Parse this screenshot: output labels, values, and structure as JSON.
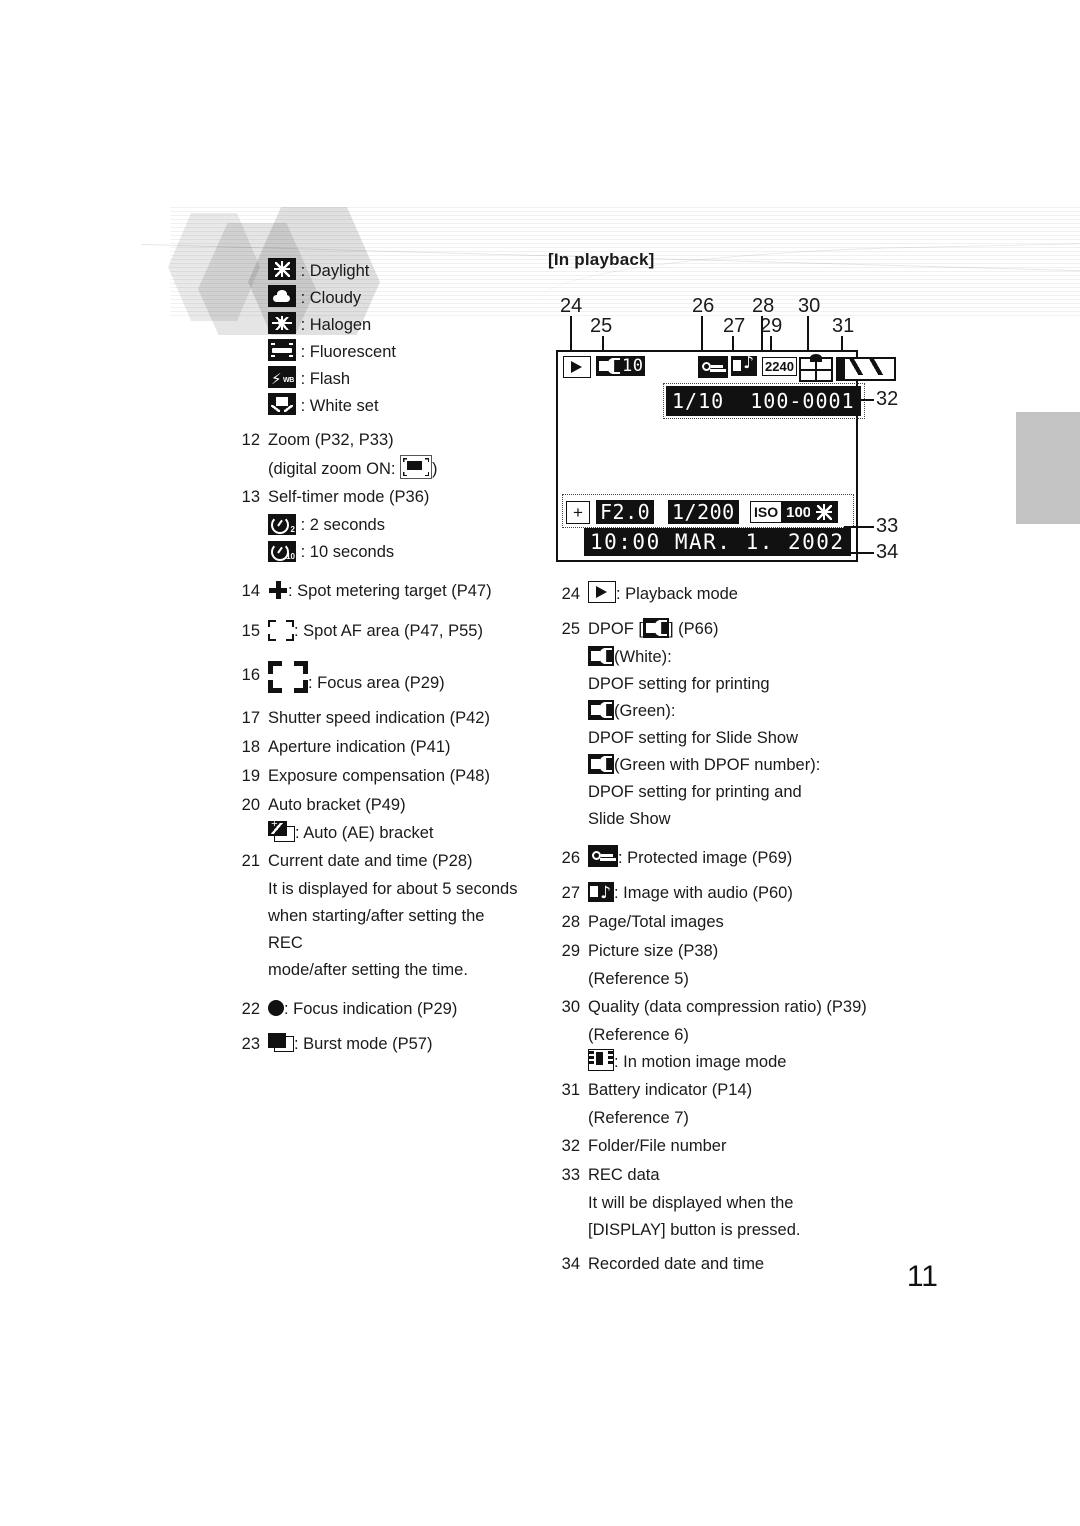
{
  "page": {
    "number": "11"
  },
  "left_column": {
    "wb_icons": [
      {
        "icon": "daylight-icon",
        "label": ": Daylight"
      },
      {
        "icon": "cloudy-icon",
        "label": ": Cloudy"
      },
      {
        "icon": "halogen-icon",
        "label": ": Halogen"
      },
      {
        "icon": "fluorescent-icon",
        "label": ": Fluorescent"
      },
      {
        "icon": "flash-wb-icon",
        "label": ": Flash"
      },
      {
        "icon": "white-set-icon",
        "label": ": White set"
      }
    ],
    "item12": {
      "num": "12",
      "text": "Zoom (P32, P33)",
      "sub_pre": "(digital zoom ON: ",
      "sub_post": ")"
    },
    "item13": {
      "num": "13",
      "text": "Self-timer mode (P36)",
      "timer2": {
        "badge": "2",
        "label": ": 2 seconds"
      },
      "timer10": {
        "badge": "10",
        "label": ": 10 seconds"
      }
    },
    "item14": {
      "num": "14",
      "text": ": Spot metering target (P47)"
    },
    "item15": {
      "num": "15",
      "text": ": Spot AF area (P47, P55)"
    },
    "item16": {
      "num": "16",
      "text": ": Focus area (P29)"
    },
    "item17": {
      "num": "17",
      "text": "Shutter speed indication (P42)"
    },
    "item18": {
      "num": "18",
      "text": "Aperture indication (P41)"
    },
    "item19": {
      "num": "19",
      "text": "Exposure compensation (P48)"
    },
    "item20": {
      "num": "20",
      "text": "Auto bracket (P49)",
      "sub": ": Auto (AE) bracket"
    },
    "item21": {
      "num": "21",
      "text": "Current date and time (P28)",
      "detail1": "It is displayed for about 5 seconds",
      "detail2": "when starting/after setting the REC",
      "detail3": "mode/after setting the time."
    },
    "item22": {
      "num": "22",
      "text": ": Focus indication (P29)"
    },
    "item23": {
      "num": "23",
      "text": ": Burst mode (P57)"
    }
  },
  "right_column": {
    "title": "[In playback]",
    "item24": {
      "num": "24",
      "text": ": Playback mode"
    },
    "item25": {
      "num": "25",
      "pre": "DPOF [",
      "post": "]  (P66)",
      "white_label": "(White):",
      "white_desc": "DPOF setting for printing",
      "green_label": "(Green):",
      "green_desc": "DPOF setting for Slide Show",
      "greennum_label": "(Green with DPOF number):",
      "greennum_desc1": "DPOF setting for printing and",
      "greennum_desc2": "Slide Show"
    },
    "item26": {
      "num": "26",
      "text": ": Protected image (P69)"
    },
    "item27": {
      "num": "27",
      "text": ": Image with audio (P60)"
    },
    "item28": {
      "num": "28",
      "text": "Page/Total images"
    },
    "item29": {
      "num": "29",
      "text": "Picture size (P38)",
      "ref": "(Reference 5)"
    },
    "item30": {
      "num": "30",
      "text": "Quality (data compression ratio) (P39)",
      "ref": "(Reference 6)",
      "motion": ": In motion image mode"
    },
    "item31": {
      "num": "31",
      "text": "Battery indicator (P14)",
      "ref": "(Reference 7)"
    },
    "item32": {
      "num": "32",
      "text": "Folder/File number"
    },
    "item33": {
      "num": "33",
      "text": "REC data",
      "detail1": "It will be displayed when the",
      "detail2": "[DISPLAY] button is pressed."
    },
    "item34": {
      "num": "34",
      "text": "Recorded date and time"
    }
  },
  "lcd_diagram": {
    "callout_numbers": {
      "c24": "24",
      "c25": "25",
      "c26": "26",
      "c27": "27",
      "c28": "28",
      "c29": "29",
      "c30": "30",
      "c31": "31",
      "c32": "32",
      "c33": "33",
      "c34": "34"
    },
    "dpof_count": "10",
    "picture_size": "2240",
    "page_total": "1/10",
    "folder_file": "100-0001",
    "ev_compensation": "+",
    "aperture": "F2.0",
    "shutter_speed": "1/200",
    "iso_label": "ISO",
    "iso_value": "100",
    "recorded_datetime": "10:00 MAR. 1. 2002"
  }
}
